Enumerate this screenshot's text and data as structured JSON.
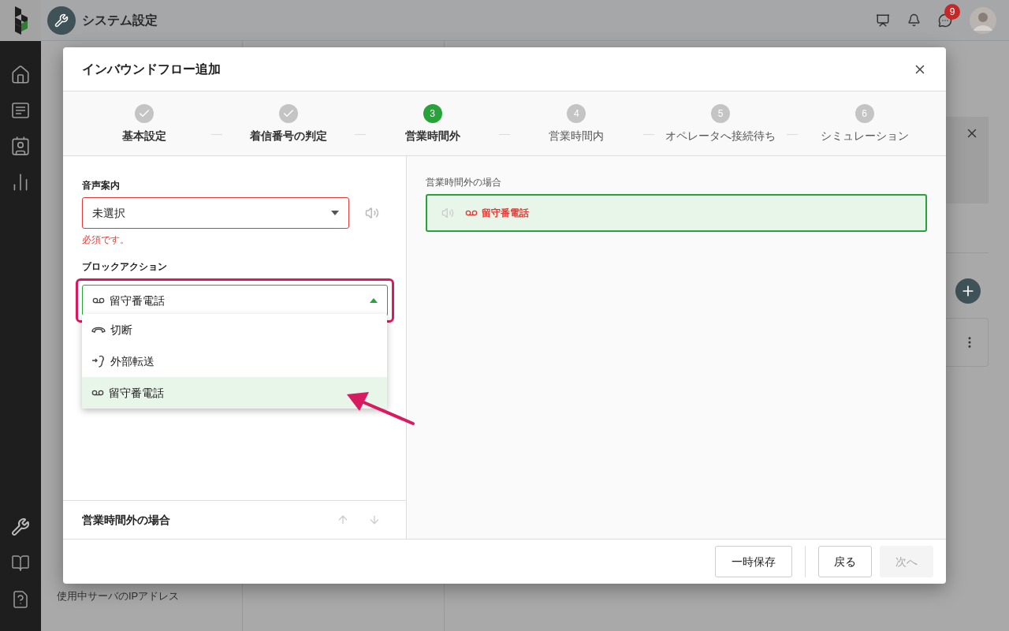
{
  "app": {
    "title": "システム設定",
    "notification_count": "9"
  },
  "settings_menu": [
    {
      "label": "使用中サーバのIPアドレス"
    }
  ],
  "dialog": {
    "title": "インバウンドフロー追加",
    "steps": [
      {
        "label": "基本設定",
        "completed": true,
        "selected": false
      },
      {
        "label": "着信番号の判定",
        "completed": true,
        "selected": false
      },
      {
        "number": "3",
        "label": "営業時間外",
        "completed": false,
        "selected": true
      },
      {
        "number": "4",
        "label": "営業時間内",
        "completed": false,
        "selected": false
      },
      {
        "number": "5",
        "label": "オペレータへ接続待ち",
        "completed": false,
        "selected": false
      },
      {
        "number": "6",
        "label": "シミュレーション",
        "completed": false,
        "selected": false
      }
    ],
    "voice_guide": {
      "label": "音声案内",
      "value": "未選択",
      "error": "必須です。"
    },
    "block_action": {
      "label": "ブロックアクション",
      "value": {
        "label": "留守番電話",
        "kind": "voicemail"
      },
      "expanded": true,
      "highlighted": true,
      "options": [
        {
          "label": "切断",
          "kind": "hangup",
          "selected": false
        },
        {
          "label": "外部転送",
          "kind": "transfer",
          "selected": false
        },
        {
          "label": "留守番電話",
          "kind": "voicemail",
          "selected": true
        }
      ]
    },
    "section": {
      "title": "営業時間外の場合"
    },
    "preview": {
      "label": "営業時間外の場合",
      "node": {
        "label": "留守番電話",
        "kind": "voicemail"
      }
    },
    "buttons": [
      {
        "label": "一時保存",
        "disabled": false
      },
      {
        "label": "戻る",
        "disabled": false
      },
      {
        "label": "次へ",
        "disabled": true
      }
    ]
  }
}
